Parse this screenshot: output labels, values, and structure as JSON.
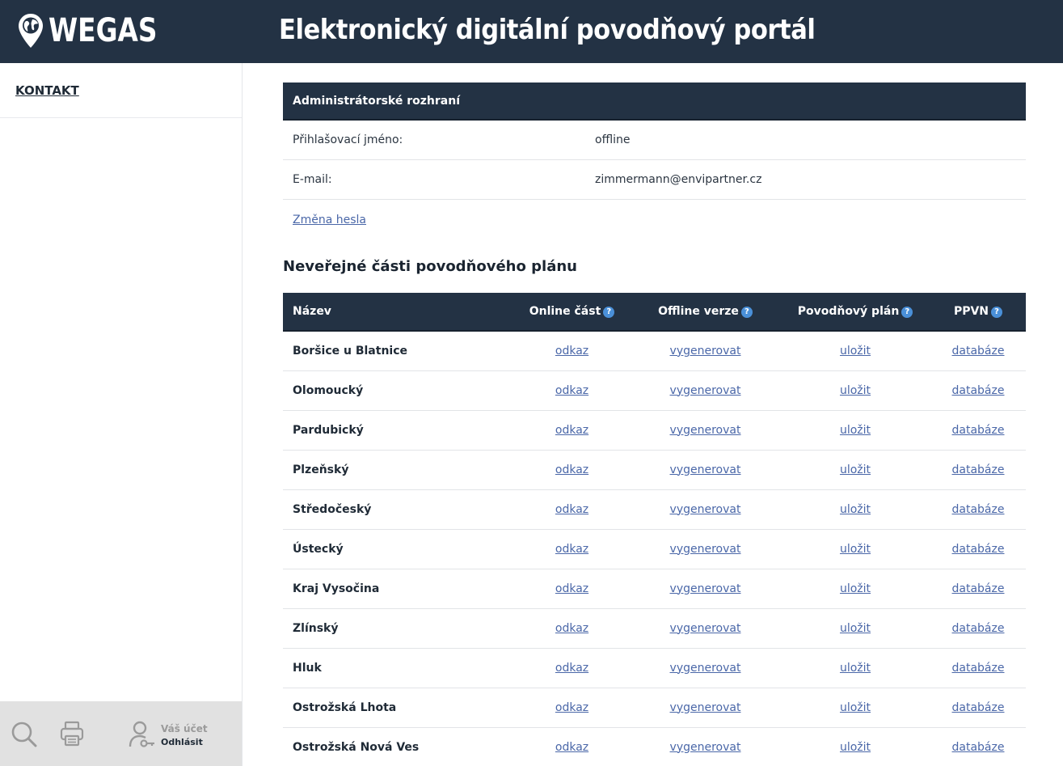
{
  "header": {
    "logo_text": "WEGAS",
    "title": "Elektronický digitální povodňový portál"
  },
  "sidebar": {
    "nav_link": "KONTAKT",
    "footer": {
      "account_label": "Váš účet",
      "logout_label": "Odhlásit"
    }
  },
  "admin_panel": {
    "title": "Administrátorské rozhraní",
    "login_label": "Přihlašovací jméno:",
    "login_value": "offline",
    "email_label": "E-mail:",
    "email_value": "zimmermann@envipartner.cz",
    "change_password": "Změna hesla"
  },
  "plans": {
    "section_title": "Neveřejné části povodňového plánu",
    "columns": {
      "name": "Název",
      "online": "Online část",
      "offline": "Offline verze",
      "plan": "Povodňový plán",
      "ppvn": "PPVN"
    },
    "help_glyph": "?",
    "link_labels": {
      "online": "odkaz",
      "offline": "vygenerovat",
      "plan": "uložit",
      "ppvn": "databáze"
    },
    "rows": [
      "Boršice u Blatnice",
      "Olomoucký",
      "Pardubický",
      "Plzeňský",
      "Středočeský",
      "Ústecký",
      "Kraj Vysočina",
      "Zlínský",
      "Hluk",
      "Ostrožská Lhota",
      "Ostrožská Nová Ves"
    ]
  },
  "colors": {
    "header_bg": "#233244",
    "link": "#4a67a8",
    "help_badge": "#4a90d9",
    "sidebar_footer_bg": "#e1e1e1"
  },
  "icons": [
    "globe-pin-icon",
    "search-icon",
    "printer-icon",
    "user-key-icon",
    "help-icon"
  ]
}
